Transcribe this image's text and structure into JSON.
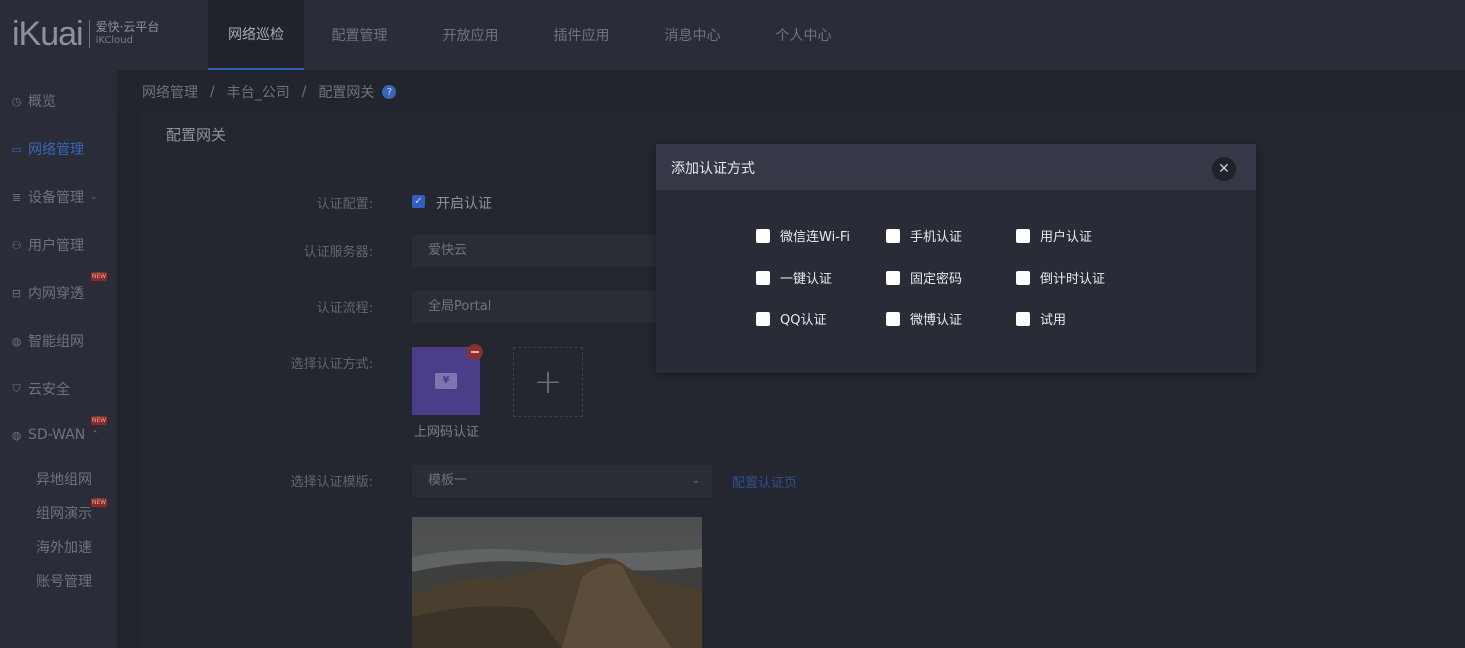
{
  "brand": {
    "mark": "iKuai",
    "cn": "爱快·云平台",
    "en": "iKCloud"
  },
  "topnav": [
    "网络巡检",
    "配置管理",
    "开放应用",
    "插件应用",
    "消息中心",
    "个人中心"
  ],
  "sidebar": {
    "items": [
      {
        "label": "概览"
      },
      {
        "label": "网络管理"
      },
      {
        "label": "设备管理"
      },
      {
        "label": "用户管理"
      },
      {
        "label": "内网穿透",
        "badge": "NEW"
      },
      {
        "label": "智能组网"
      },
      {
        "label": "云安全"
      },
      {
        "label": "SD-WAN",
        "badge": "NEW"
      }
    ],
    "subitems": [
      {
        "label": "异地组网"
      },
      {
        "label": "组网演示",
        "badge": "NEW"
      },
      {
        "label": "海外加速"
      },
      {
        "label": "账号管理"
      }
    ]
  },
  "breadcrumb": [
    "网络管理",
    "丰台_公司",
    "配置网关"
  ],
  "panel": {
    "title": "配置网关",
    "labels": {
      "auth_config": "认证配置:",
      "auth_server": "认证服务器:",
      "auth_flow": "认证流程:",
      "auth_method": "选择认证方式:",
      "auth_template": "选择认证模版:"
    },
    "enable_auth": "开启认证",
    "auth_server_value": "爱快云",
    "auth_flow_value": "全局Portal",
    "method_tile_label": "上网码认证",
    "template_value": "模板一",
    "configure_link": "配置认证页"
  },
  "modal": {
    "title": "添加认证方式",
    "options": [
      "微信连Wi-Fi",
      "手机认证",
      "用户认证",
      "一键认证",
      "固定密码",
      "倒计时认证",
      "QQ认证",
      "微博认证",
      "试用"
    ]
  },
  "icons": {
    "close": "close-icon",
    "help": "help-icon",
    "add": "plus-icon",
    "remove": "minus-icon"
  },
  "colors": {
    "accent": "#2f5fbf",
    "tile": "#4b3d87",
    "badge": "#8a2a2a"
  }
}
